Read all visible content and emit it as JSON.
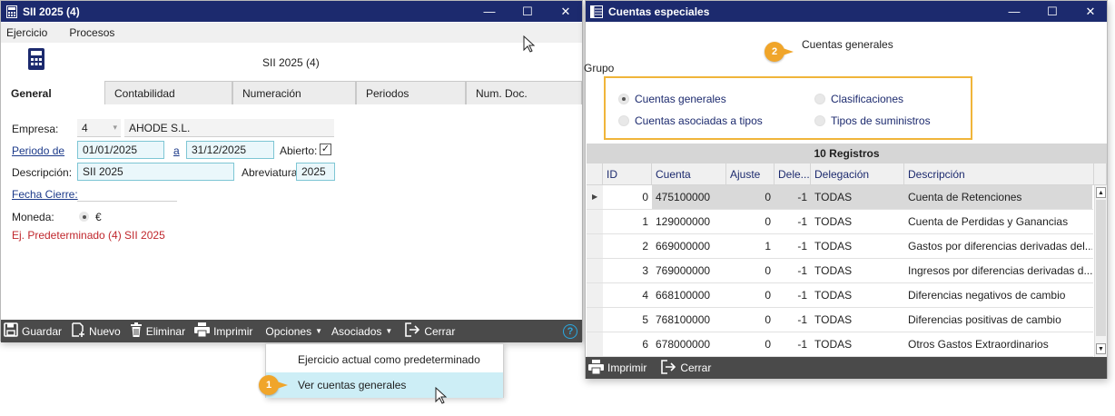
{
  "left_window": {
    "title": "SII 2025 (4)",
    "menu": [
      "Ejercicio",
      "Procesos"
    ],
    "header_title": "SII 2025 (4)",
    "tabs": [
      "General",
      "Contabilidad",
      "Numeración",
      "Periodos",
      "Num. Doc."
    ],
    "form": {
      "empresa_label": "Empresa:",
      "empresa_code": "4",
      "empresa_name": "AHODE S.L.",
      "periodo_label": "Periodo de",
      "periodo_from": "01/01/2025",
      "periodo_sep": "a",
      "periodo_to": "31/12/2025",
      "abierto_label": "Abierto:",
      "abierto_checked": true,
      "descripcion_label": "Descripción:",
      "descripcion_value": "SII 2025",
      "abreviatura_label": "Abreviatura",
      "abreviatura_value": "2025",
      "fecha_cierre_label": "Fecha Cierre:",
      "moneda_label": "Moneda:",
      "moneda_value": "€",
      "predeterminado_text": "Ej. Predeterminado (4) SII 2025"
    },
    "toolbar": {
      "guardar": "Guardar",
      "nuevo": "Nuevo",
      "eliminar": "Eliminar",
      "imprimir": "Imprimir",
      "opciones": "Opciones",
      "asociados": "Asociados",
      "cerrar": "Cerrar"
    }
  },
  "dropdown": {
    "items": [
      "Ejercicio actual como predeterminado",
      "Ver cuentas generales"
    ],
    "highlighted_index": 1
  },
  "callouts": {
    "one": "1",
    "two": "2"
  },
  "right_window": {
    "title": "Cuentas especiales",
    "header_caption": "Cuentas generales",
    "group_label": "Grupo",
    "radios": [
      {
        "label": "Cuentas generales",
        "selected": true
      },
      {
        "label": "Clasificaciones",
        "selected": false
      },
      {
        "label": "Cuentas asociadas a tipos",
        "selected": false
      },
      {
        "label": "Tipos de suministros",
        "selected": false
      }
    ],
    "records_label": "10 Registros",
    "columns": [
      "ID",
      "Cuenta",
      "Ajuste",
      "Dele...",
      "Delegación",
      "Descripción"
    ],
    "rows": [
      {
        "id": "0",
        "cuenta": "475100000",
        "ajuste": "0",
        "dele": "-1",
        "delegacion": "TODAS",
        "descripcion": "Cuenta de Retenciones"
      },
      {
        "id": "1",
        "cuenta": "129000000",
        "ajuste": "0",
        "dele": "-1",
        "delegacion": "TODAS",
        "descripcion": "Cuenta de Perdidas y Ganancias"
      },
      {
        "id": "2",
        "cuenta": "669000000",
        "ajuste": "1",
        "dele": "-1",
        "delegacion": "TODAS",
        "descripcion": "Gastos por diferencias derivadas del..."
      },
      {
        "id": "3",
        "cuenta": "769000000",
        "ajuste": "0",
        "dele": "-1",
        "delegacion": "TODAS",
        "descripcion": "Ingresos por diferencias derivadas d..."
      },
      {
        "id": "4",
        "cuenta": "668100000",
        "ajuste": "0",
        "dele": "-1",
        "delegacion": "TODAS",
        "descripcion": "Diferencias negativos de cambio"
      },
      {
        "id": "5",
        "cuenta": "768100000",
        "ajuste": "0",
        "dele": "-1",
        "delegacion": "TODAS",
        "descripcion": "Diferencias positivas de cambio"
      },
      {
        "id": "6",
        "cuenta": "678000000",
        "ajuste": "0",
        "dele": "-1",
        "delegacion": "TODAS",
        "descripcion": "Otros Gastos Extraordinarios"
      }
    ],
    "toolbar": {
      "imprimir": "Imprimir",
      "cerrar": "Cerrar"
    }
  },
  "colors": {
    "titlebar": "#1c2a6e",
    "toolbar": "#4a4a4a",
    "callout": "#f0a52a",
    "error_text": "#c0272d",
    "highlight": "#cdeef6"
  }
}
